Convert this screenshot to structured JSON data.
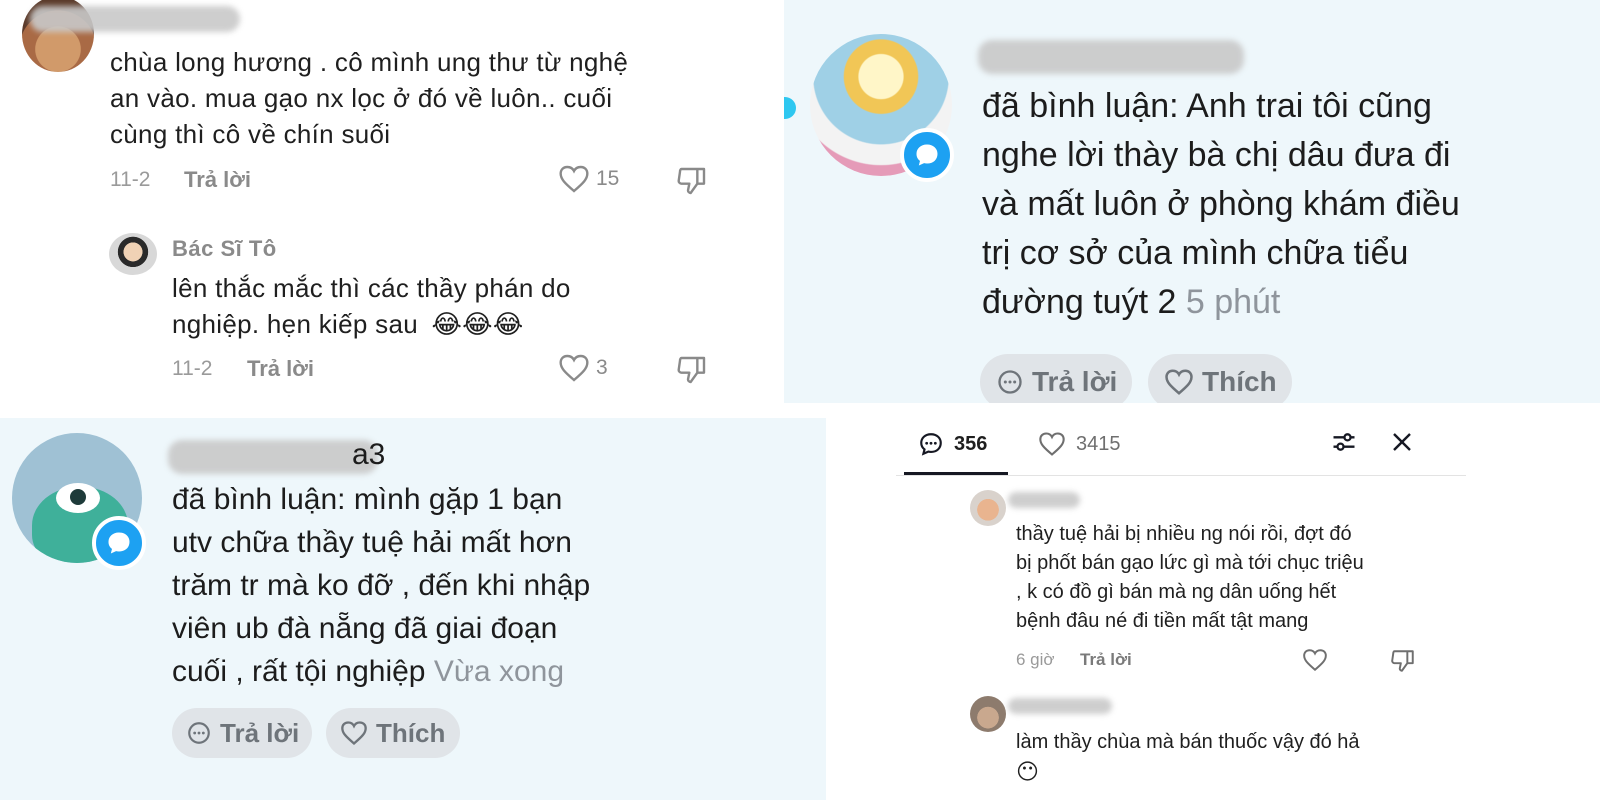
{
  "panel1": {
    "comment1": {
      "text_line1": "chùa long hương . cô mình ung thư từ nghệ",
      "text_line2": "an vào. mua gạo nx lọc ở đó về luôn.. cuối",
      "text_line3": "cùng thì cô về chín suối",
      "date": "11-2",
      "reply_label": "Trả lời",
      "like_count": "15"
    },
    "comment2": {
      "username": "Bác Sĩ Tô",
      "text_line1": "lên thắc mắc thì các thầy phán do",
      "text_line2": "nghiệp. hẹn kiếp sau",
      "emojis": "😂😂😂",
      "date": "11-2",
      "reply_label": "Trả lời",
      "like_count": "3"
    }
  },
  "panel2": {
    "text_line1": "đã bình luận: Anh trai tôi cũng",
    "text_line2": "nghe lời thày bà chị dâu đưa đi",
    "text_line3": "và mất luôn ở phòng khám điều",
    "text_line4": "trị cơ sở của mình chữa tiểu",
    "text_line5": "đường tuýt 2",
    "time": "5 phút",
    "reply_label": "Trả lời",
    "like_label": "Thích"
  },
  "panel3": {
    "username_visible": "a3",
    "text_line1": "đã bình luận: mình gặp 1 bạn",
    "text_line2": "utv chữa thầy tuệ hải mất hơn",
    "text_line3": "trăm tr mà ko đỡ , đến khi nhập",
    "text_line4": "viên ub đà nẵng đã giai đoạn",
    "text_line5": "cuối , rất tội nghiệp",
    "time": "Vừa xong",
    "reply_label": "Trả lời",
    "like_label": "Thích"
  },
  "panel4": {
    "tabs": {
      "comments_count": "356",
      "likes_count": "3415"
    },
    "comment1": {
      "text_line1": "thầy tuệ hải bị nhiều ng nói rồi, đợt đó",
      "text_line2": "bị phốt bán gạo lức gì mà tới chục triệu",
      "text_line3": ", k có đồ gì bán mà ng dân uống hết",
      "text_line4": "bệnh đâu né đi tiền mất tật mang",
      "time": "6 giờ",
      "reply_label": "Trả lời"
    },
    "comment2": {
      "text_line1": "làm thầy chùa mà bán thuốc vậy đó hả",
      "emoji": "😶"
    }
  },
  "colors": {
    "panel_bg_blue": "#eef7fb",
    "verified_blue": "#1da1f2",
    "online_dot": "#2ec7f0",
    "pill_bg": "#e0e4e8",
    "tab_underline": "#161823"
  }
}
